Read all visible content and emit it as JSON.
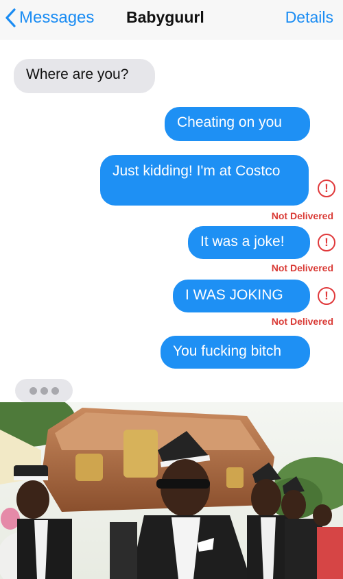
{
  "header": {
    "back_label": "Messages",
    "contact_name": "Babyguurl",
    "details_label": "Details",
    "accent": "#1a8cf3"
  },
  "messages": [
    {
      "direction": "incoming",
      "text": "Where are you?",
      "status": ""
    },
    {
      "direction": "outgoing",
      "text": "Cheating on you",
      "status": ""
    },
    {
      "direction": "outgoing",
      "text": "Just kidding! I'm at Costco",
      "status": "Not Delivered"
    },
    {
      "direction": "outgoing",
      "text": "It was a joke!",
      "status": "Not Delivered"
    },
    {
      "direction": "outgoing",
      "text": "I WAS JOKING",
      "status": "Not Delivered"
    },
    {
      "direction": "outgoing",
      "text": "You fucking bitch",
      "status": ""
    }
  ],
  "alert_glyph": "!",
  "colors": {
    "outgoing_bubble": "#1e90f4",
    "incoming_bubble": "#e6e6ea",
    "error": "#e0393b"
  },
  "icons": {
    "back": "chevron-left-icon",
    "alert": "exclamation-circle-icon",
    "typing": "typing-indicator"
  }
}
